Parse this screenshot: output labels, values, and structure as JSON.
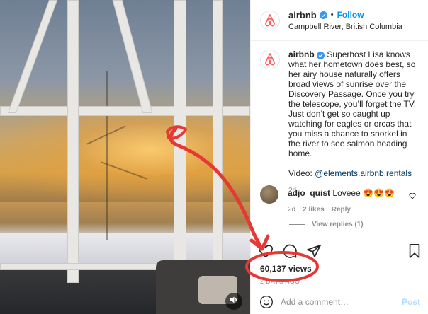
{
  "post": {
    "username": "airbnb",
    "follow_label": "Follow",
    "separator": "•",
    "location": "Campbell River, British Columbia"
  },
  "caption": {
    "username": "airbnb",
    "text": "Superhost Lisa knows what her hometown does best, so her airy house naturally offers broad views of sunrise over the Discovery Passage. Once you try the telescope, you’ll forget the TV. Just don’t get so caught up watching for eagles or orcas that you miss a chance to snorkel in the river to see salmon heading home.",
    "video_label": "Video:",
    "video_link": "@elements.airbnb.rentals",
    "time": "2d"
  },
  "comment": {
    "username": "adjo_quist",
    "text": "Loveee 😍😍😍",
    "time": "2d",
    "likes": "2 likes",
    "reply_label": "Reply",
    "view_replies": "View replies (1)"
  },
  "stats": {
    "views": "60,137 views",
    "date": "2 DAYS AGO"
  },
  "add_comment": {
    "placeholder": "Add a comment…",
    "post_label": "Post"
  },
  "media": {
    "volume_icon": "volume-muted-icon"
  },
  "colors": {
    "brand": "#ff5a5f",
    "follow": "#0095f6",
    "annotation": "#e53935",
    "verified": "#3897f0"
  }
}
